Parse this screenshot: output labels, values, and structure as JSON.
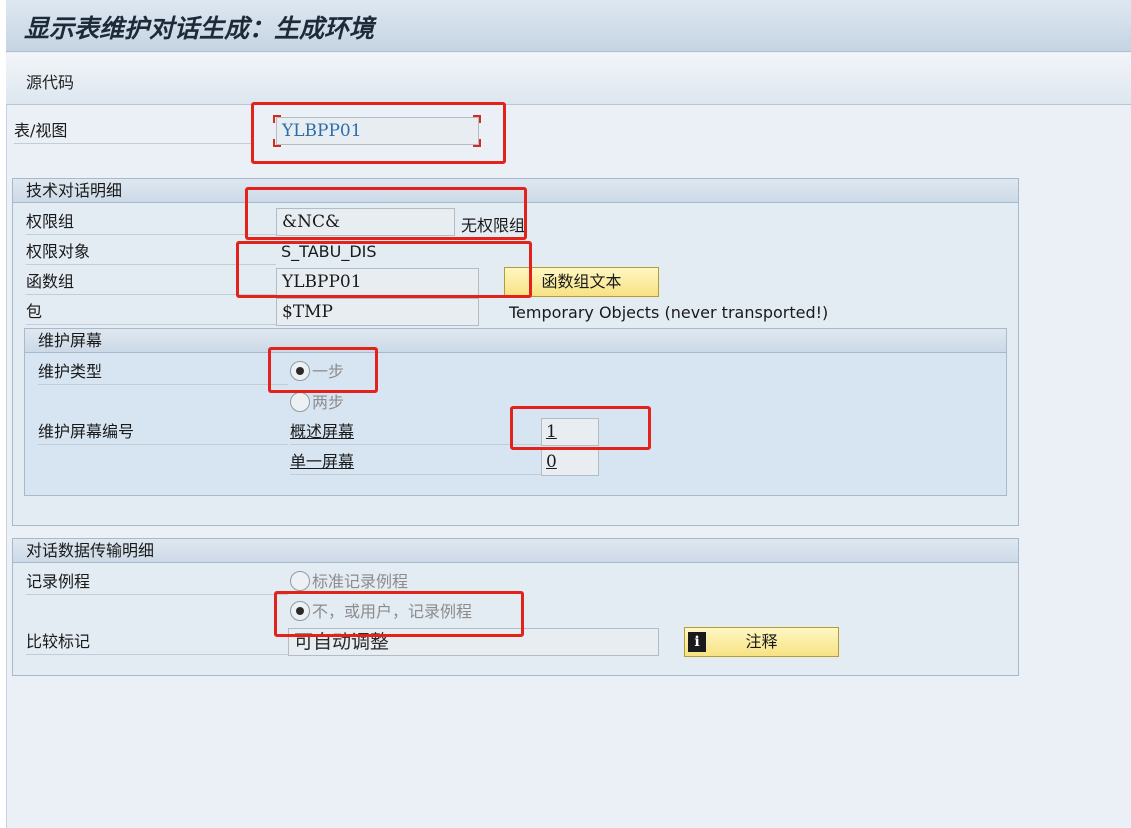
{
  "window": {
    "title": "显示表维护对话生成：生成环境"
  },
  "toolbar": {
    "source_code": "源代码"
  },
  "table_view": {
    "label": "表/视图",
    "value": "YLBPP01"
  },
  "tech_details": {
    "title": "技术对话明细",
    "auth_group": {
      "label": "权限组",
      "value": "&NC&",
      "desc": "无权限组"
    },
    "auth_object": {
      "label": "权限对象",
      "value": "S_TABU_DIS"
    },
    "function_group": {
      "label": "函数组",
      "value": "YLBPP01",
      "button": "函数组文本"
    },
    "package": {
      "label": "包",
      "value": "$TMP",
      "desc": "Temporary Objects (never transported!)"
    },
    "maintenance_screen": {
      "title": "维护屏幕",
      "type_label": "维护类型",
      "option_one_step": "一步",
      "option_two_step": "两步",
      "selected": "一步",
      "screen_no_label": "维护屏幕编号",
      "overview_label": "概述屏幕",
      "overview_value": "1",
      "single_label": "单一屏幕",
      "single_value": "0"
    }
  },
  "transport_details": {
    "title": "对话数据传输明细",
    "recording_label": "记录例程",
    "option_standard": "标准记录例程",
    "option_none": "不，或用户，记录例程",
    "selected": "不，或用户，记录例程",
    "compare_label": "比较标记",
    "compare_value": "可自动调整",
    "notes_button": "注释",
    "info_icon_glyph": "i"
  },
  "colors": {
    "highlight": "#e3221c",
    "button_fill": "#f7e283",
    "frame_bg": "#eaf0f6"
  }
}
